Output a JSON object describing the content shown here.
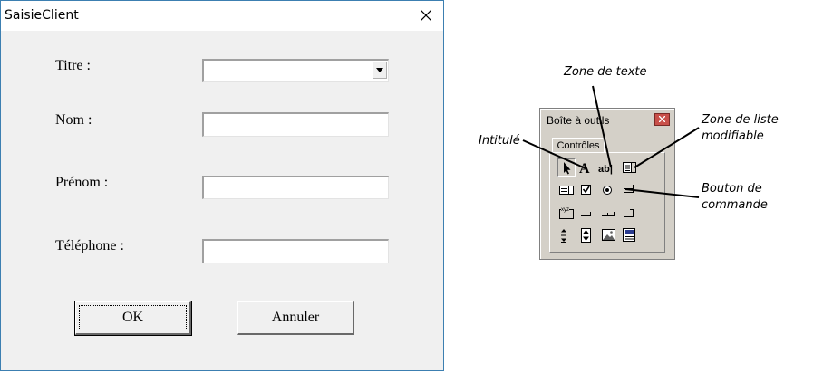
{
  "dialog": {
    "title": "SaisieClient",
    "fields": [
      {
        "label": "Titre :",
        "type": "combobox",
        "value": ""
      },
      {
        "label": "Nom :",
        "type": "textbox",
        "value": ""
      },
      {
        "label": "Prénom :",
        "type": "textbox",
        "value": ""
      },
      {
        "label": "Téléphone :",
        "type": "textbox",
        "value": ""
      }
    ],
    "ok_label": "OK",
    "cancel_label": "Annuler"
  },
  "toolbox": {
    "title": "Boîte à outils",
    "tab_label": "Contrôles",
    "text_glyph": "ab|",
    "label_glyph": "A",
    "frame_glyph": "xyz",
    "tools": [
      "select-pointer-icon",
      "label-icon",
      "textbox-icon",
      "combobox-icon",
      "listbox-icon",
      "checkbox-icon",
      "option-button-icon",
      "toggle-button-icon",
      "frame-icon",
      "command-button-icon",
      "tabstrip-icon",
      "multipage-icon",
      "scrollbar-icon",
      "spinbutton-icon",
      "image-icon",
      "refedit-icon"
    ]
  },
  "annotations": {
    "textbox": "Zone de texte",
    "label": "Intitulé",
    "combobox_line1": "Zone de liste",
    "combobox_line2": "modifiable",
    "button_line1": "Bouton de",
    "button_line2": "commande"
  },
  "colors": {
    "dialog_border": "#3c7fb1",
    "dialog_background": "#f0f0f0",
    "toolbox_background": "#d4d0c8",
    "toolbox_close": "#c8504a"
  }
}
